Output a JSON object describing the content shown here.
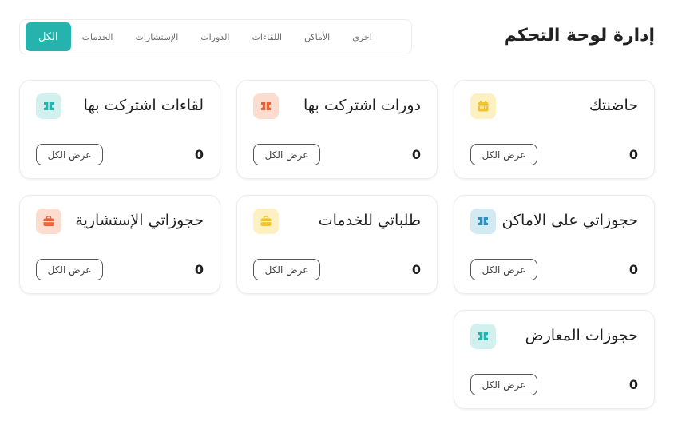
{
  "header": {
    "title": "إدارة لوحة التحكم"
  },
  "filters": {
    "tabs": [
      {
        "label": "الكل",
        "active": true
      },
      {
        "label": "الخدمات",
        "active": false
      },
      {
        "label": "الإستشارات",
        "active": false
      },
      {
        "label": "الدورات",
        "active": false
      },
      {
        "label": "اللقاءات",
        "active": false
      },
      {
        "label": "الأماكن",
        "active": false
      },
      {
        "label": "اخرى",
        "active": false
      }
    ],
    "accent": "#27b3ad"
  },
  "cards": [
    {
      "title": "حاضنتك",
      "count": "0",
      "view_all": "عرض الكل",
      "icon": "calendar-icon",
      "icon_color": "#f2c230",
      "icon_bg": "#fdf0c2"
    },
    {
      "title": "دورات اشتركت بها",
      "count": "0",
      "view_all": "عرض الكل",
      "icon": "ticket-icon",
      "icon_color": "#e8643a",
      "icon_bg": "#fbdccf"
    },
    {
      "title": "لقاءات اشتركت بها",
      "count": "0",
      "view_all": "عرض الكل",
      "icon": "ticket-icon",
      "icon_color": "#27b3ad",
      "icon_bg": "#d2f0ee"
    },
    {
      "title": "حجوزاتي على الاماكن",
      "count": "0",
      "view_all": "عرض الكل",
      "icon": "ticket-icon",
      "icon_color": "#2f8fbf",
      "icon_bg": "#d3eaf3"
    },
    {
      "title": "طلباتي للخدمات",
      "count": "0",
      "view_all": "عرض الكل",
      "icon": "briefcase-icon",
      "icon_color": "#f2c230",
      "icon_bg": "#fdf0c2"
    },
    {
      "title": "حجوزاتي الإستشارية",
      "count": "0",
      "view_all": "عرض الكل",
      "icon": "briefcase-icon",
      "icon_color": "#e8643a",
      "icon_bg": "#fbdccf"
    },
    {
      "title": "حجوزات المعارض",
      "count": "0",
      "view_all": "عرض الكل",
      "icon": "ticket-icon",
      "icon_color": "#27b3ad",
      "icon_bg": "#d2f0ee"
    }
  ]
}
